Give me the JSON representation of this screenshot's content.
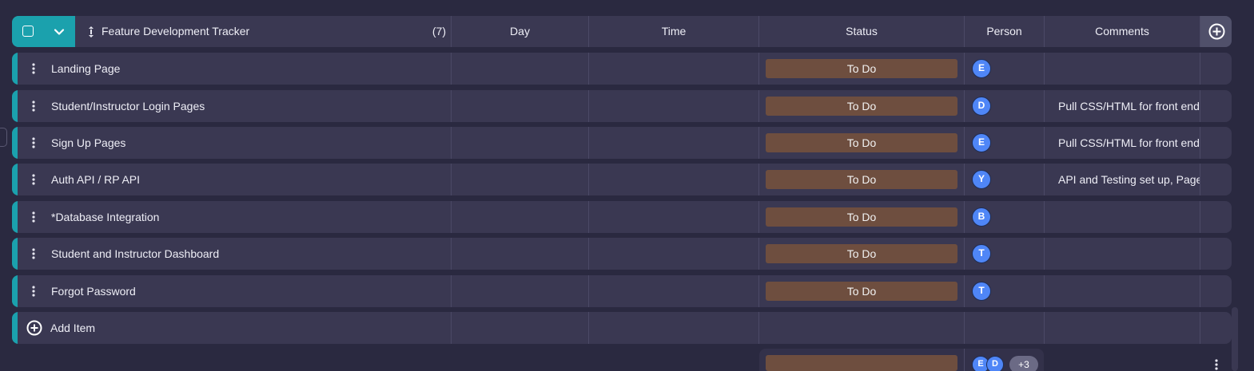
{
  "group": {
    "title": "Feature Development Tracker",
    "count": "(7)",
    "accent": "#1ba1ad"
  },
  "columns": {
    "day": "Day",
    "time": "Time",
    "status": "Status",
    "person": "Person",
    "comments": "Comments"
  },
  "items": [
    {
      "name": "Landing Page",
      "status": "To Do",
      "person": "E",
      "comment": ""
    },
    {
      "name": "Student/Instructor Login Pages",
      "status": "To Do",
      "person": "D",
      "comment": "Pull CSS/HTML for front end"
    },
    {
      "name": "Sign Up Pages",
      "status": "To Do",
      "person": "E",
      "comment": "Pull CSS/HTML for front end"
    },
    {
      "name": "Auth API / RP API",
      "status": "To Do",
      "person": "Y",
      "comment": "API and Testing set up, Page"
    },
    {
      "name": "*Database Integration",
      "status": "To Do",
      "person": "B",
      "comment": ""
    },
    {
      "name": "Student and Instructor Dashboard",
      "status": "To Do",
      "person": "T",
      "comment": ""
    },
    {
      "name": "Forgot Password",
      "status": "To Do",
      "person": "T",
      "comment": ""
    }
  ],
  "add_item_label": "Add Item",
  "summary": {
    "avatars": [
      "E",
      "D"
    ],
    "more": "+3"
  },
  "colors": {
    "status_todo": "#6e4e3f",
    "avatar": "#4f86f7",
    "row_bg": "#3a3852",
    "page_bg": "#2a2940"
  },
  "icons": {
    "select_all": "checkbox-icon",
    "collapse": "chevron-down-icon",
    "drag": "drag-handle-icon",
    "row_menu": "kebab-menu-icon",
    "add_column": "plus-circle-icon",
    "add_item": "plus-circle-icon"
  }
}
